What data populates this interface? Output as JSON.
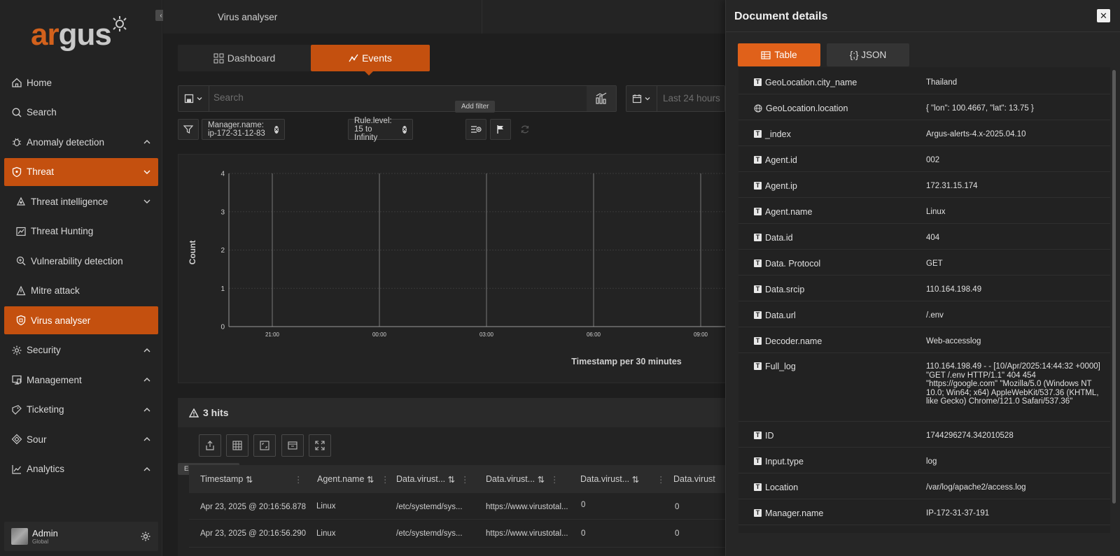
{
  "app": {
    "logo_text": "argus",
    "breadcrumb": "Virus analyser"
  },
  "sidebar": {
    "items": [
      {
        "label": "Home",
        "icon": "home-icon"
      },
      {
        "label": "Search",
        "icon": "search-icon"
      },
      {
        "label": "Anomaly detection",
        "icon": "bug-icon"
      },
      {
        "label": "Threat",
        "icon": "shield-icon"
      },
      {
        "label": "Threat intelligence",
        "icon": "intel-icon"
      },
      {
        "label": "Threat Hunting",
        "icon": "hunting-icon"
      },
      {
        "label": "Vulnerability detection",
        "icon": "vulnerability-icon"
      },
      {
        "label": "Mitre attack",
        "icon": "mitre-icon"
      },
      {
        "label": "Virus analyser",
        "icon": "virus-shield-icon"
      },
      {
        "label": "Security",
        "icon": "gear-icon"
      },
      {
        "label": "Management",
        "icon": "management-icon"
      },
      {
        "label": "Ticketing",
        "icon": "ticket-icon"
      },
      {
        "label": "Sour",
        "icon": "diamond-icon"
      },
      {
        "label": "Analytics",
        "icon": "analytics-icon"
      }
    ],
    "user": {
      "name": "Admin",
      "role": "Global"
    }
  },
  "tabs": {
    "dashboard": "Dashboard",
    "events": "Events"
  },
  "search": {
    "placeholder": "Search",
    "date_placeholder": "Last 24 hours"
  },
  "filters": {
    "pills": [
      "Manager.name: ip-172-31-12-83",
      "Rule.level: 15 to Infinity"
    ],
    "add_filter_tooltip": "Add filter"
  },
  "chart_data": {
    "type": "bar",
    "ylabel": "Count",
    "xlabel": "Timestamp per 30 minutes",
    "y_ticks": [
      0,
      1,
      2,
      3,
      4
    ],
    "x_ticks": [
      "21:00",
      "00:00",
      "03:00",
      "06:00",
      "09:00"
    ],
    "ylim": [
      0,
      4
    ],
    "grid": true
  },
  "hits": {
    "title": "3 hits",
    "export_tooltip": "Export formatted",
    "columns": [
      "Timestamp",
      "Agent.name",
      "Data.virust...",
      "Data.virust...",
      "Data.virust...",
      "Data.virust"
    ],
    "rows": [
      [
        "Apr 23, 2025 @ 20:16:56.878",
        "Linux",
        "/etc/systemd/sys...",
        "https://www.virustotal...",
        "0",
        "0"
      ],
      [
        "Apr 23, 2025 @ 20:16:56.290",
        "Linux",
        "/etc/systemd/sys...",
        "https://www.virustotal...",
        "0",
        "0"
      ]
    ]
  },
  "flyout": {
    "title": "Document details",
    "tab_table": "Table",
    "tab_json": "{;} JSON",
    "fields": [
      {
        "type": "T",
        "name": "GeoLocation.city_name",
        "value": "Thailand"
      },
      {
        "type": "geo",
        "name": "GeoLocation.location",
        "value": "{ \"lon\": 100.4667, \"lat\": 13.75 }"
      },
      {
        "type": "T",
        "name": "_index",
        "value": "Argus-alerts-4.x-2025.04.10"
      },
      {
        "type": "T",
        "name": "Agent.id",
        "value": "002"
      },
      {
        "type": "T",
        "name": "Agent.ip",
        "value": "172.31.15.174"
      },
      {
        "type": "T",
        "name": "Agent.name",
        "value": "Linux"
      },
      {
        "type": "T",
        "name": "Data.id",
        "value": "404"
      },
      {
        "type": "T",
        "name": "Data. Protocol",
        "value": "GET"
      },
      {
        "type": "T",
        "name": "Data.srcip",
        "value": "110.164.198.49"
      },
      {
        "type": "T",
        "name": "Data.url",
        "value": "/.env"
      },
      {
        "type": "T",
        "name": "Decoder.name",
        "value": "Web-accesslog"
      },
      {
        "type": "T",
        "name": "Full_log",
        "value": "110.164.198.49 - - [10/Apr/2025:14:44:32 +0000] \"GET /.env HTTP/1.1\" 404 454 \"https://google.com\" \"Mozilla/5.0 (Windows NT 10.0; Win64; x64) AppleWebKit/537.36 (KHTML, like Gecko) Chrome/121.0 Safari/537.36\""
      },
      {
        "type": "T",
        "name": "ID",
        "value": "1744296274.342010528"
      },
      {
        "type": "T",
        "name": "Input.type",
        "value": "log"
      },
      {
        "type": "T",
        "name": "Location",
        "value": "/var/log/apache2/access.log"
      },
      {
        "type": "T",
        "name": "Manager.name",
        "value": "IP-172-31-37-191"
      }
    ]
  },
  "colors": {
    "accent": "#c4500f",
    "accent_bright": "#e0611a",
    "bg": "#1e1e1e"
  }
}
